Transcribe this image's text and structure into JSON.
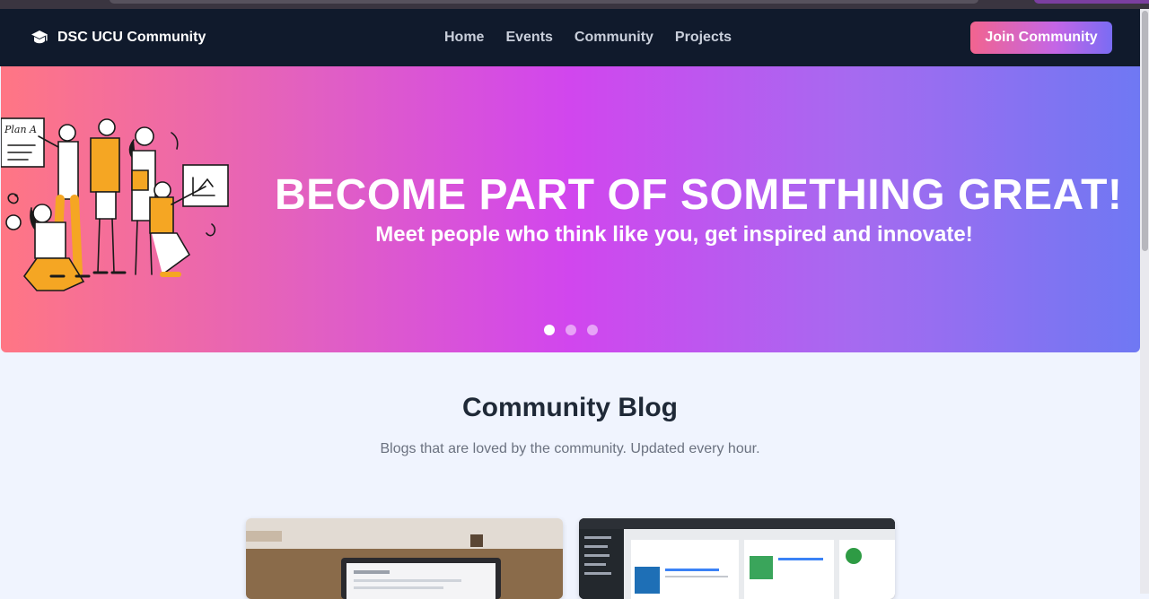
{
  "navbar": {
    "brand": "DSC UCU Community",
    "links": [
      "Home",
      "Events",
      "Community",
      "Projects"
    ],
    "cta": "Join Community"
  },
  "hero": {
    "title": "BECOME PART OF SOMETHING GREAT!",
    "subtitle": "Meet people who think like you, get inspired and innovate!",
    "slides": 3,
    "active_slide": 0,
    "sign_text": "Plan A"
  },
  "blog": {
    "title": "Community Blog",
    "subtitle": "Blogs that are loved by the community. Updated every hour."
  },
  "cards": [
    {
      "image": "laptop-workspace-photo"
    },
    {
      "image": "wordpress-dashboard-screenshot"
    }
  ],
  "colors": {
    "navbar": "#101a2c",
    "page_bg": "#f0f4fe",
    "hero_gradient": [
      "#ff7684",
      "#d146ee",
      "#6f78f3"
    ],
    "illustration_accent": "#f5a623"
  }
}
